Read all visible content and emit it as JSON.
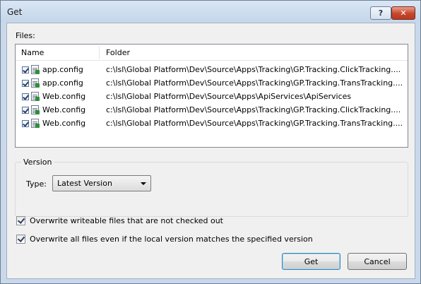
{
  "window": {
    "title": "Get",
    "help_label": "?",
    "close_label": "✕"
  },
  "files": {
    "label": "Files:",
    "columns": {
      "name": "Name",
      "folder": "Folder"
    },
    "rows": [
      {
        "checked": true,
        "name": "app.config",
        "folder": "c:\\lsl\\Global Platform\\Dev\\Source\\Apps\\Tracking\\GP.Tracking.ClickTracking...."
      },
      {
        "checked": true,
        "name": "app.config",
        "folder": "c:\\lsl\\Global Platform\\Dev\\Source\\Apps\\Tracking\\GP.Tracking.TransTracking...."
      },
      {
        "checked": true,
        "name": "Web.config",
        "folder": "c:\\lsl\\Global Platform\\Dev\\Source\\Apps\\ApiServices\\ApiServices"
      },
      {
        "checked": true,
        "name": "Web.config",
        "folder": "c:\\lsl\\Global Platform\\Dev\\Source\\Apps\\Tracking\\GP.Tracking.ClickTracking...."
      },
      {
        "checked": true,
        "name": "Web.config",
        "folder": "c:\\lsl\\Global Platform\\Dev\\Source\\Apps\\Tracking\\GP.Tracking.TransTracking...."
      }
    ]
  },
  "version": {
    "legend": "Version",
    "type_label": "Type:",
    "type_value": "Latest Version"
  },
  "options": {
    "overwrite_writeable": {
      "checked": true,
      "label": "Overwrite writeable files that are not checked out"
    },
    "overwrite_all": {
      "checked": true,
      "label": "Overwrite all files even if the local version matches the specified version"
    }
  },
  "buttons": {
    "get": "Get",
    "cancel": "Cancel"
  }
}
